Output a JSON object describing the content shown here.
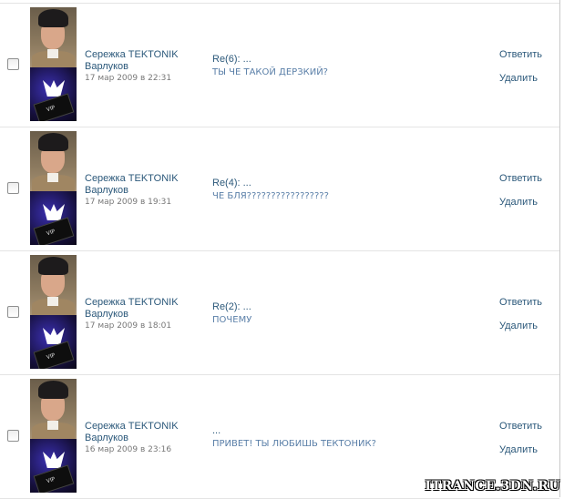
{
  "messages": [
    {
      "author_first": "Сережка TEKTONIK",
      "author_last": "Варлуков",
      "date": "17 мар 2009 в 22:31",
      "subject": "Re(6): ...",
      "preview": "ТЫ ЧЕ ТАКОЙ ДЕРЗКИЙ?",
      "reply_label": "Ответить",
      "delete_label": "Удалить"
    },
    {
      "author_first": "Сережка TEKTONIK",
      "author_last": "Варлуков",
      "date": "17 мар 2009 в 19:31",
      "subject": "Re(4): ...",
      "preview": "ЧЕ БЛЯ?????????????????",
      "reply_label": "Ответить",
      "delete_label": "Удалить"
    },
    {
      "author_first": "Сережка TEKTONIK",
      "author_last": "Варлуков",
      "date": "17 мар 2009 в 18:01",
      "subject": "Re(2): ...",
      "preview": "ПОЧЕМУ",
      "reply_label": "Ответить",
      "delete_label": "Удалить"
    },
    {
      "author_first": "Сережка TEKTONIK",
      "author_last": "Варлуков",
      "date": "16 мар 2009 в 23:16",
      "subject": "...",
      "preview": "ПРИВЕТ! ТЫ ЛЮБИШЬ ТЕКТОНИК?",
      "reply_label": "Ответить",
      "delete_label": "Удалить"
    }
  ],
  "avatar_card_text": "VIP",
  "watermark": "ITRANCE.3DN.RU",
  "colors": {
    "link": "#2b587a",
    "preview": "#5a7fa8",
    "date": "#777777",
    "divider": "#e4e4e4"
  }
}
